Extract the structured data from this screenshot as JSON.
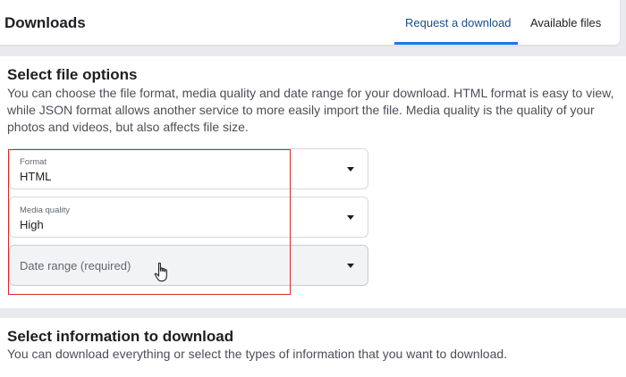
{
  "header": {
    "title": "Downloads",
    "tabs": [
      {
        "label": "Request a download",
        "active": true
      },
      {
        "label": "Available files",
        "active": false
      }
    ],
    "accent_color": "#1877f2"
  },
  "file_options": {
    "title": "Select file options",
    "description": "You can choose the file format, media quality and date range for your download. HTML format is easy to view, while JSON format allows another service to more easily import the file. Media quality is the quality of your photos and videos, but also affects file size.",
    "fields": {
      "format": {
        "label": "Format",
        "value": "HTML"
      },
      "media_quality": {
        "label": "Media quality",
        "value": "High"
      },
      "date_range": {
        "placeholder": "Date range (required)"
      }
    }
  },
  "info_section": {
    "title": "Select information to download",
    "description": "You can download everything or select the types of information that you want to download."
  },
  "annotation": {
    "highlight_color": "#e02424"
  }
}
